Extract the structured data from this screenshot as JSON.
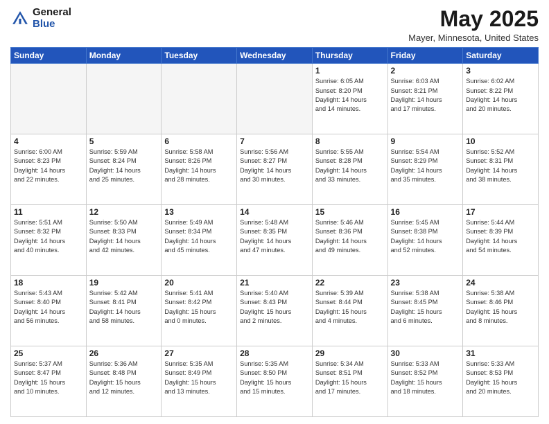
{
  "logo": {
    "general": "General",
    "blue": "Blue"
  },
  "header": {
    "month": "May 2025",
    "location": "Mayer, Minnesota, United States"
  },
  "weekdays": [
    "Sunday",
    "Monday",
    "Tuesday",
    "Wednesday",
    "Thursday",
    "Friday",
    "Saturday"
  ],
  "weeks": [
    [
      {
        "day": "",
        "info": "",
        "empty": true
      },
      {
        "day": "",
        "info": "",
        "empty": true
      },
      {
        "day": "",
        "info": "",
        "empty": true
      },
      {
        "day": "",
        "info": "",
        "empty": true
      },
      {
        "day": "1",
        "info": "Sunrise: 6:05 AM\nSunset: 8:20 PM\nDaylight: 14 hours\nand 14 minutes.",
        "empty": false
      },
      {
        "day": "2",
        "info": "Sunrise: 6:03 AM\nSunset: 8:21 PM\nDaylight: 14 hours\nand 17 minutes.",
        "empty": false
      },
      {
        "day": "3",
        "info": "Sunrise: 6:02 AM\nSunset: 8:22 PM\nDaylight: 14 hours\nand 20 minutes.",
        "empty": false
      }
    ],
    [
      {
        "day": "4",
        "info": "Sunrise: 6:00 AM\nSunset: 8:23 PM\nDaylight: 14 hours\nand 22 minutes.",
        "empty": false
      },
      {
        "day": "5",
        "info": "Sunrise: 5:59 AM\nSunset: 8:24 PM\nDaylight: 14 hours\nand 25 minutes.",
        "empty": false
      },
      {
        "day": "6",
        "info": "Sunrise: 5:58 AM\nSunset: 8:26 PM\nDaylight: 14 hours\nand 28 minutes.",
        "empty": false
      },
      {
        "day": "7",
        "info": "Sunrise: 5:56 AM\nSunset: 8:27 PM\nDaylight: 14 hours\nand 30 minutes.",
        "empty": false
      },
      {
        "day": "8",
        "info": "Sunrise: 5:55 AM\nSunset: 8:28 PM\nDaylight: 14 hours\nand 33 minutes.",
        "empty": false
      },
      {
        "day": "9",
        "info": "Sunrise: 5:54 AM\nSunset: 8:29 PM\nDaylight: 14 hours\nand 35 minutes.",
        "empty": false
      },
      {
        "day": "10",
        "info": "Sunrise: 5:52 AM\nSunset: 8:31 PM\nDaylight: 14 hours\nand 38 minutes.",
        "empty": false
      }
    ],
    [
      {
        "day": "11",
        "info": "Sunrise: 5:51 AM\nSunset: 8:32 PM\nDaylight: 14 hours\nand 40 minutes.",
        "empty": false
      },
      {
        "day": "12",
        "info": "Sunrise: 5:50 AM\nSunset: 8:33 PM\nDaylight: 14 hours\nand 42 minutes.",
        "empty": false
      },
      {
        "day": "13",
        "info": "Sunrise: 5:49 AM\nSunset: 8:34 PM\nDaylight: 14 hours\nand 45 minutes.",
        "empty": false
      },
      {
        "day": "14",
        "info": "Sunrise: 5:48 AM\nSunset: 8:35 PM\nDaylight: 14 hours\nand 47 minutes.",
        "empty": false
      },
      {
        "day": "15",
        "info": "Sunrise: 5:46 AM\nSunset: 8:36 PM\nDaylight: 14 hours\nand 49 minutes.",
        "empty": false
      },
      {
        "day": "16",
        "info": "Sunrise: 5:45 AM\nSunset: 8:38 PM\nDaylight: 14 hours\nand 52 minutes.",
        "empty": false
      },
      {
        "day": "17",
        "info": "Sunrise: 5:44 AM\nSunset: 8:39 PM\nDaylight: 14 hours\nand 54 minutes.",
        "empty": false
      }
    ],
    [
      {
        "day": "18",
        "info": "Sunrise: 5:43 AM\nSunset: 8:40 PM\nDaylight: 14 hours\nand 56 minutes.",
        "empty": false
      },
      {
        "day": "19",
        "info": "Sunrise: 5:42 AM\nSunset: 8:41 PM\nDaylight: 14 hours\nand 58 minutes.",
        "empty": false
      },
      {
        "day": "20",
        "info": "Sunrise: 5:41 AM\nSunset: 8:42 PM\nDaylight: 15 hours\nand 0 minutes.",
        "empty": false
      },
      {
        "day": "21",
        "info": "Sunrise: 5:40 AM\nSunset: 8:43 PM\nDaylight: 15 hours\nand 2 minutes.",
        "empty": false
      },
      {
        "day": "22",
        "info": "Sunrise: 5:39 AM\nSunset: 8:44 PM\nDaylight: 15 hours\nand 4 minutes.",
        "empty": false
      },
      {
        "day": "23",
        "info": "Sunrise: 5:38 AM\nSunset: 8:45 PM\nDaylight: 15 hours\nand 6 minutes.",
        "empty": false
      },
      {
        "day": "24",
        "info": "Sunrise: 5:38 AM\nSunset: 8:46 PM\nDaylight: 15 hours\nand 8 minutes.",
        "empty": false
      }
    ],
    [
      {
        "day": "25",
        "info": "Sunrise: 5:37 AM\nSunset: 8:47 PM\nDaylight: 15 hours\nand 10 minutes.",
        "empty": false
      },
      {
        "day": "26",
        "info": "Sunrise: 5:36 AM\nSunset: 8:48 PM\nDaylight: 15 hours\nand 12 minutes.",
        "empty": false
      },
      {
        "day": "27",
        "info": "Sunrise: 5:35 AM\nSunset: 8:49 PM\nDaylight: 15 hours\nand 13 minutes.",
        "empty": false
      },
      {
        "day": "28",
        "info": "Sunrise: 5:35 AM\nSunset: 8:50 PM\nDaylight: 15 hours\nand 15 minutes.",
        "empty": false
      },
      {
        "day": "29",
        "info": "Sunrise: 5:34 AM\nSunset: 8:51 PM\nDaylight: 15 hours\nand 17 minutes.",
        "empty": false
      },
      {
        "day": "30",
        "info": "Sunrise: 5:33 AM\nSunset: 8:52 PM\nDaylight: 15 hours\nand 18 minutes.",
        "empty": false
      },
      {
        "day": "31",
        "info": "Sunrise: 5:33 AM\nSunset: 8:53 PM\nDaylight: 15 hours\nand 20 minutes.",
        "empty": false
      }
    ]
  ]
}
